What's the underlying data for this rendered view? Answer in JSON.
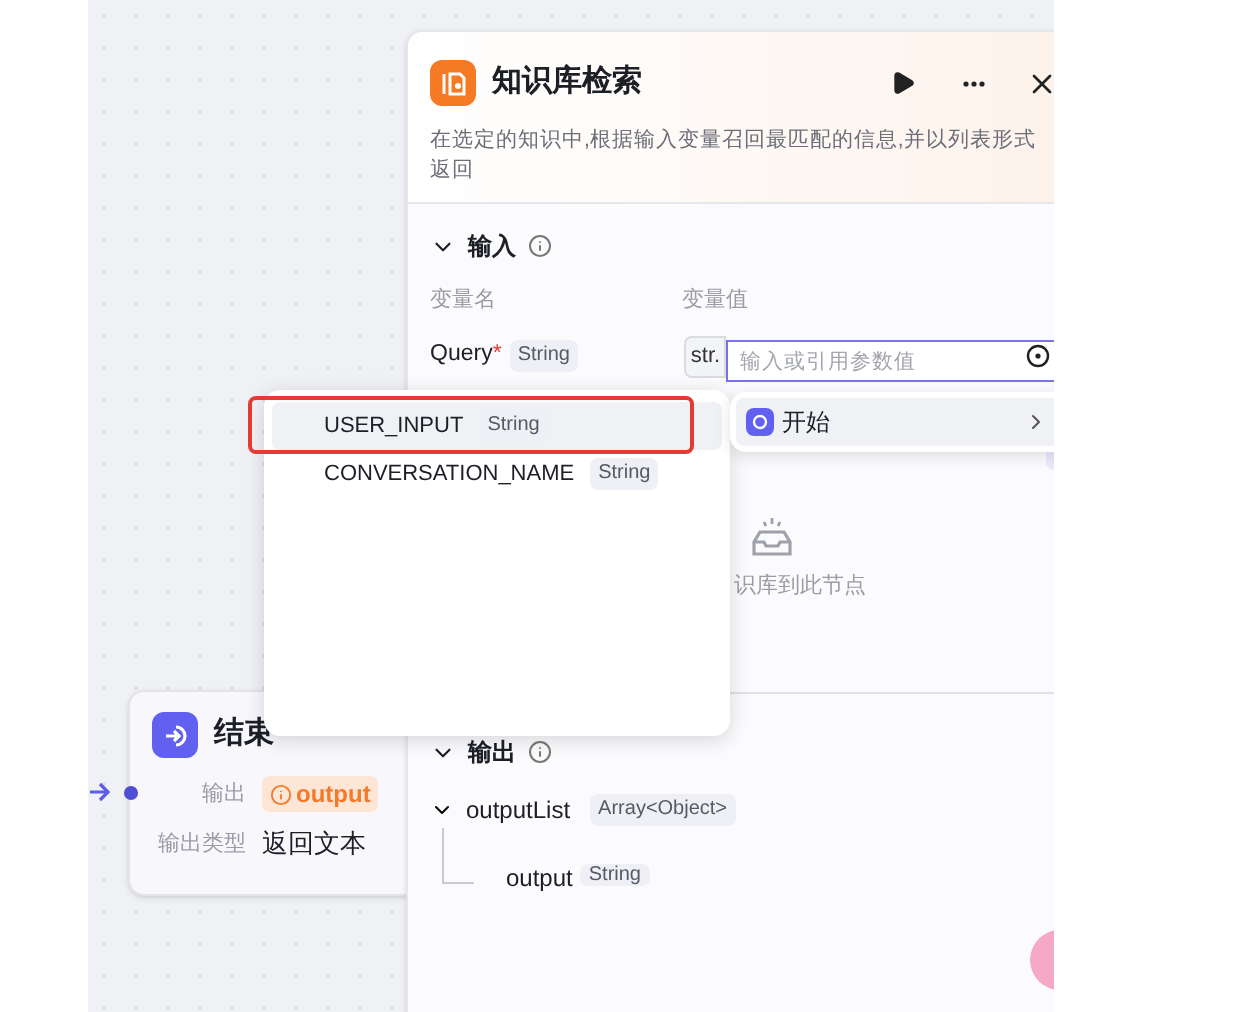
{
  "end_node": {
    "title": "结束",
    "output_label": "输出",
    "output_value": "output",
    "output_type_label": "输出类型",
    "output_type": "返回文本"
  },
  "panel": {
    "title": "知识库检索",
    "description": "在选定的知识中,根据输入变量召回最匹配的信息,并以列表形式返回",
    "input": {
      "title": "输入",
      "expanded": true,
      "columns": [
        "变量名",
        "变量值"
      ],
      "rows": [
        {
          "name": "Query",
          "required": true,
          "required_mark": "*",
          "type": "String",
          "mode": "str.",
          "placeholder": "输入或引用参数值"
        }
      ]
    },
    "knowledge_hint": "识库到此节点",
    "output": {
      "title": "输出",
      "tree": [
        {
          "name": "outputList",
          "type": "Array<Object>",
          "expanded": true,
          "children": [
            {
              "name": "output",
              "type": "String"
            }
          ]
        }
      ]
    }
  },
  "variable_menu": {
    "items": [
      {
        "name": "USER_INPUT",
        "type": "String",
        "selected": true,
        "highlighted": true
      },
      {
        "name": "CONVERSATION_NAME",
        "type": "String",
        "selected": false,
        "highlighted": false
      }
    ]
  },
  "node_submenu": {
    "label": "开始"
  }
}
